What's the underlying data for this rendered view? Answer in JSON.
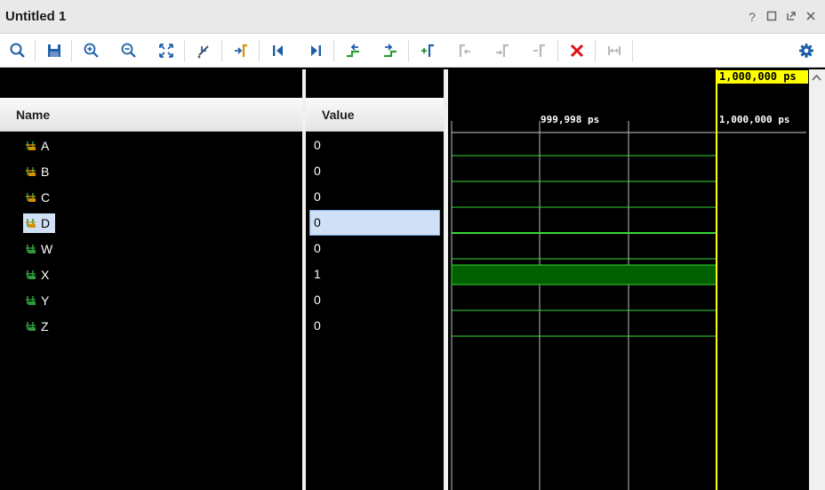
{
  "window": {
    "title": "Untitled 1",
    "controls": [
      "help-icon",
      "maximize-icon",
      "float-icon",
      "close-icon"
    ]
  },
  "toolbar": {
    "buttons": [
      {
        "name": "search-icon"
      },
      {
        "name": "save-icon"
      },
      {
        "name": "zoom-in-icon"
      },
      {
        "name": "zoom-out-icon"
      },
      {
        "name": "zoom-fit-icon"
      },
      {
        "name": "cursor-snap-icon"
      },
      {
        "name": "go-to-cursor-icon"
      },
      {
        "name": "go-to-time-zero-icon"
      },
      {
        "name": "go-to-last-time-icon"
      },
      {
        "name": "previous-transition-icon"
      },
      {
        "name": "next-transition-icon"
      },
      {
        "name": "add-marker-icon"
      },
      {
        "name": "previous-marker-icon"
      },
      {
        "name": "next-marker-icon"
      },
      {
        "name": "delete-marker-icon"
      },
      {
        "name": "delete-all-markers-icon"
      },
      {
        "name": "swap-cursors-icon"
      },
      {
        "name": "settings-icon"
      }
    ],
    "colors": {
      "blue": "#1e5fa8",
      "green": "#2e9a3c",
      "red": "#e01010",
      "disabled": "#b8b8b8",
      "orange": "#d99000"
    }
  },
  "columns": {
    "name": "Name",
    "value": "Value"
  },
  "signals": [
    {
      "name": "A",
      "value": "0",
      "type": "input",
      "selected": false
    },
    {
      "name": "B",
      "value": "0",
      "type": "input",
      "selected": false
    },
    {
      "name": "C",
      "value": "0",
      "type": "input",
      "selected": false
    },
    {
      "name": "D",
      "value": "0",
      "type": "input",
      "selected": true
    },
    {
      "name": "W",
      "value": "0",
      "type": "output",
      "selected": false
    },
    {
      "name": "X",
      "value": "1",
      "type": "output",
      "selected": false
    },
    {
      "name": "Y",
      "value": "0",
      "type": "output",
      "selected": false
    },
    {
      "name": "Z",
      "value": "0",
      "type": "output",
      "selected": false
    }
  ],
  "timeline": {
    "cursor_time": "1,000,000 ps",
    "marks": [
      {
        "label": "999,998 ps"
      },
      {
        "label": "1,000,000 ps"
      }
    ]
  },
  "colors": {
    "wave": "#35d835",
    "wave_high_fill": "#006000",
    "cursor": "#ffff00",
    "selection": "#cfe0f7"
  }
}
